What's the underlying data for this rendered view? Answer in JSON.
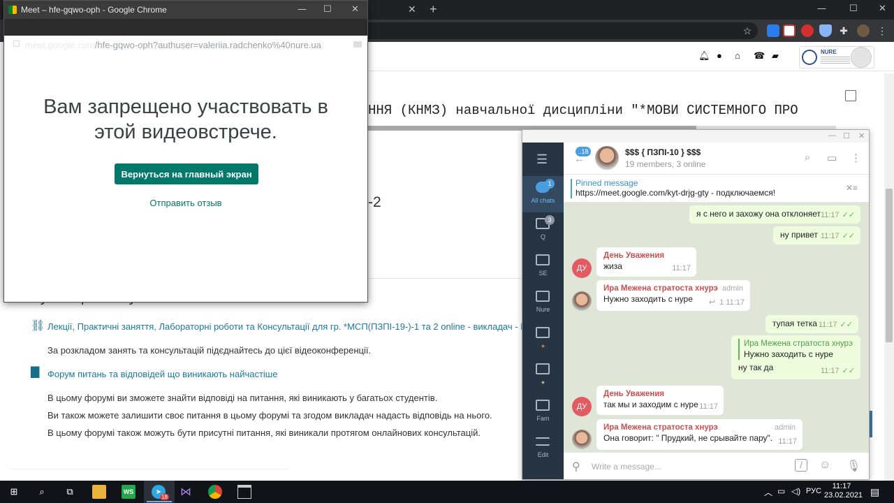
{
  "chrome_bg": {
    "tab_close": "✕",
    "new_tab": "+",
    "window_controls": {
      "minimize": "—",
      "maximize": "☐",
      "close": "✕"
    }
  },
  "moodle": {
    "course_title": "ННЯ (КНМЗ) навчальної дисципліни \"*МОВИ СИСТЕМНОГО ПРО",
    "group_suffix": "-2",
    "logo_text": "NURE",
    "section_heading": "Консультаційний пункт",
    "resources": [
      {
        "icon": "link-icon",
        "text": "Лекції, Практичні заняття, Лабораторні роботи та Консультації для гр. *МСП(ПЗПІ-19-)-1 та 2 online - викладач - Мельн"
      },
      {
        "icon": "forum-icon",
        "text": "Форум питань та відповідей що виникають найчастіше"
      }
    ],
    "paragraphs": [
      "За розкладом занять та консультацій  підєднайтесь до цієї відеоконференції.",
      "В цьому форумі ви зможете знайти відповіді на питання, які виникають у багатьох студентів.",
      "Ви також можете залишити своє питання в цьому форумі та згодом викладач надасть відповідь на нього.",
      "В цьому форумі також можуть бути присутні питання, які виникали протягом онлайнових консультацій."
    ]
  },
  "meet": {
    "window_title": "Meet – hfe-gqwo-oph - Google Chrome",
    "url_host": "meet.google.com",
    "url_path": "/hfe-gqwo-oph?authuser=valeriia.radchenko%40nure.ua",
    "heading_line1": "Вам запрещено участвовать в",
    "heading_line2": "этой видеовстрече.",
    "return_button": "Вернуться на главный экран",
    "feedback_link": "Отправить отзыв",
    "brand_colors": {
      "primary": "#00796b"
    }
  },
  "telegram": {
    "window_controls": {
      "minimize": "—",
      "maximize": "☐",
      "close": "✕"
    },
    "menu_icon": "☰",
    "folders": [
      {
        "label": "All chats",
        "badge": "1"
      },
      {
        "label": "Q",
        "badge": "3"
      },
      {
        "label": "SE",
        "badge": ""
      },
      {
        "label": "Nure",
        "badge": ""
      },
      {
        "label": "",
        "badge": ""
      },
      {
        "label": "",
        "badge": ""
      },
      {
        "label": "Fam",
        "badge": ""
      },
      {
        "label": "Edit",
        "badge": ""
      }
    ],
    "back_badge": "..18",
    "chat_title": "$$$ { ПЗПІ-10 } $$$",
    "chat_subtitle": "19 members, 3 online",
    "pinned_title": "Pinned message",
    "pinned_text": "https://meet.google.com/kyt-drjg-gty - подключаемся!",
    "messages": [
      {
        "text": "я с него и захожу она отклоняет",
        "time": "11:17"
      },
      {
        "text": "ну привет",
        "time": "11:17"
      },
      {
        "author": "День Уважения",
        "avatar": "ДУ",
        "text": "жиза",
        "time": "11:17"
      },
      {
        "author": "Ира Межена стратоста хнурэ",
        "badge": "admin",
        "text": "Нужно заходить с нуре",
        "replies": "1",
        "time": "11:17"
      },
      {
        "text": "тупая тетка",
        "time": "11:17"
      },
      {
        "reply_author": "Ира Межена стратоста хнурэ",
        "reply_text": "Нужно заходить с нуре",
        "text": "ну так да",
        "time": "11:17"
      },
      {
        "author": "День Уважения",
        "avatar": "ДУ",
        "text": "так мы и заходим с нуре",
        "time": "11:17"
      },
      {
        "author": "Ира Межена стратоста хнурэ",
        "badge": "admin",
        "text": "Она говорит: \" Прудкий, не срывайте пару\".",
        "time": "11:17"
      }
    ],
    "input_placeholder": "Write a message...",
    "ticks": "✓✓"
  },
  "taskbar": {
    "language": "РУС",
    "time": "11:17",
    "date": "23.02.2021",
    "telegram_badge": "18"
  }
}
